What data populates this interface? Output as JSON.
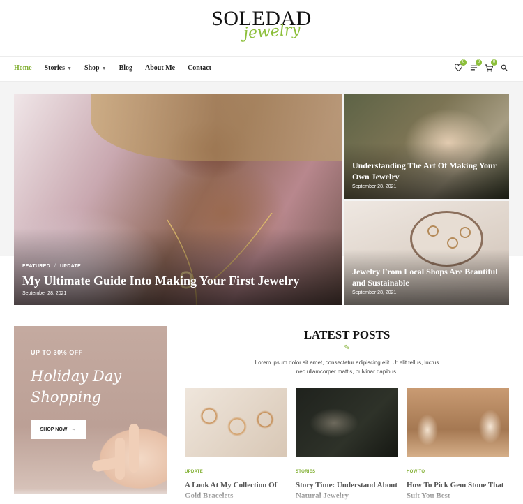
{
  "logo": {
    "main": "SOLEDAD",
    "script": "jewelry"
  },
  "nav": {
    "items": [
      {
        "label": "Home",
        "active": true,
        "dropdown": false
      },
      {
        "label": "Stories",
        "active": false,
        "dropdown": true
      },
      {
        "label": "Shop",
        "active": false,
        "dropdown": true
      },
      {
        "label": "Blog",
        "active": false,
        "dropdown": false
      },
      {
        "label": "About Me",
        "active": false,
        "dropdown": false
      },
      {
        "label": "Contact",
        "active": false,
        "dropdown": false
      }
    ],
    "icons": [
      {
        "name": "heart-icon",
        "badge": "0"
      },
      {
        "name": "compare-icon",
        "badge": "0"
      },
      {
        "name": "cart-icon",
        "badge": "0"
      },
      {
        "name": "search-icon",
        "badge": ""
      }
    ]
  },
  "featured": {
    "main": {
      "tags": [
        "FEATURED",
        "UPDATE"
      ],
      "title": "My Ultimate Guide Into Making Your First Jewelry",
      "date": "September 28, 2021"
    },
    "side": [
      {
        "title": "Understanding The Art Of Making Your Own Jewelry",
        "date": "September 28, 2021"
      },
      {
        "title": "Jewelry From Local Shops Are Beautiful and Sustainable",
        "date": "September 28, 2021"
      }
    ]
  },
  "promo": {
    "offer": "UP TO 30% OFF",
    "title": "Holiday Day Shopping",
    "button": "SHOP NOW"
  },
  "latest": {
    "title": "LATEST POSTS",
    "description": "Lorem ipsum dolor sit amet, consectetur adipiscing elit. Ut elit tellus, luctus nec ullamcorper mattis, pulvinar dapibus.",
    "posts": [
      {
        "category": "UPDATE",
        "title": "A Look At My Collection Of Gold Bracelets"
      },
      {
        "category": "STORIES",
        "title": "Story Time: Understand About Natural Jewelry"
      },
      {
        "category": "HOW TO",
        "title": "How To Pick Gem Stone That Suit You Best"
      }
    ]
  },
  "colors": {
    "accent": "#7fae2e"
  }
}
